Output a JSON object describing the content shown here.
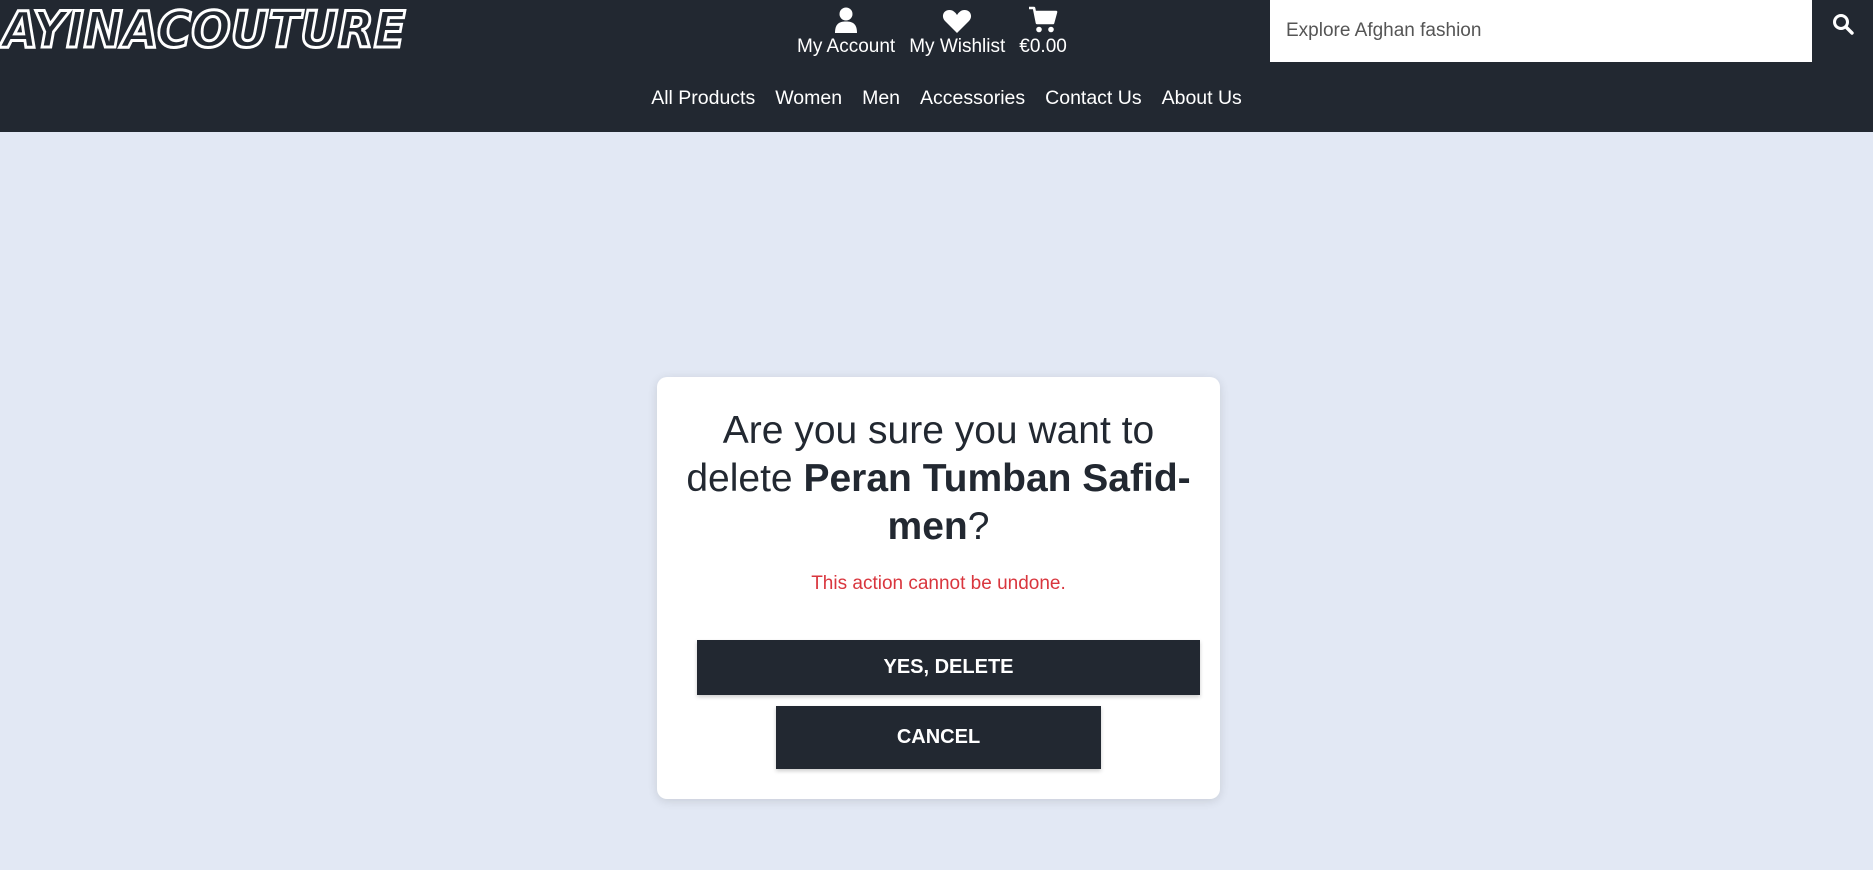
{
  "brand": {
    "logo_text": "AYINACOUTURE"
  },
  "account": {
    "my_account": "My Account",
    "my_wishlist": "My Wishlist",
    "cart_total": "€0.00"
  },
  "search": {
    "placeholder": "Explore Afghan fashion"
  },
  "nav": {
    "items": [
      "All Products",
      "Women",
      "Men",
      "Accessories",
      "Contact Us",
      "About Us"
    ]
  },
  "modal": {
    "question_prefix": "Are you sure you want to delete ",
    "product_name": "Peran Tumban Safid-men",
    "question_suffix": "?",
    "warning": "This action cannot be undone.",
    "confirm_label": "YES, DELETE",
    "cancel_label": "CANCEL"
  },
  "colors": {
    "header_bg": "#222831",
    "page_bg": "#e2e8f4",
    "warning": "#d9363e",
    "button_bg": "#222831"
  },
  "icons": [
    "user-icon",
    "heart-icon",
    "cart-icon",
    "search-icon"
  ]
}
